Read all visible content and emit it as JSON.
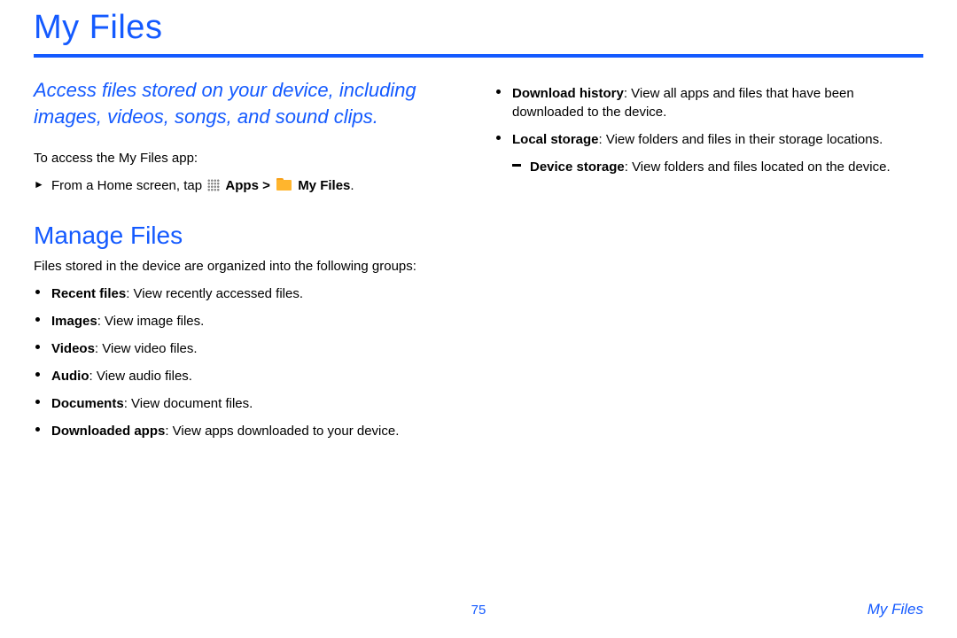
{
  "title": "My Files",
  "blurb": "Access files stored on your device, including images, videos, songs, and sound clips.",
  "access_intro": "To access the My Files app:",
  "step_prefix": "From a Home screen, tap ",
  "step_apps": "Apps",
  "step_gt": " > ",
  "step_myfiles": "My Files",
  "step_period": ".",
  "h2": "Manage Files",
  "groups_intro": "Files stored in the device are organized into the following groups:",
  "left_items": [
    {
      "term": "Recent files",
      "desc": ": View recently accessed files."
    },
    {
      "term": "Images",
      "desc": ": View image files."
    },
    {
      "term": "Videos",
      "desc": ": View video files."
    },
    {
      "term": "Audio",
      "desc": ": View audio files."
    },
    {
      "term": "Documents",
      "desc": ": View document files."
    },
    {
      "term": "Downloaded apps",
      "desc": ": View apps downloaded to your device."
    }
  ],
  "right_items": [
    {
      "term": "Download history",
      "desc": ": View all apps and files that have been downloaded to the device."
    },
    {
      "term": "Local storage",
      "desc": ": View folders and files in their storage locations.",
      "sub": [
        {
          "term": "Device storage",
          "desc": ": View folders and files located on the device."
        }
      ]
    }
  ],
  "page_number": "75",
  "breadcrumb": "My Files"
}
